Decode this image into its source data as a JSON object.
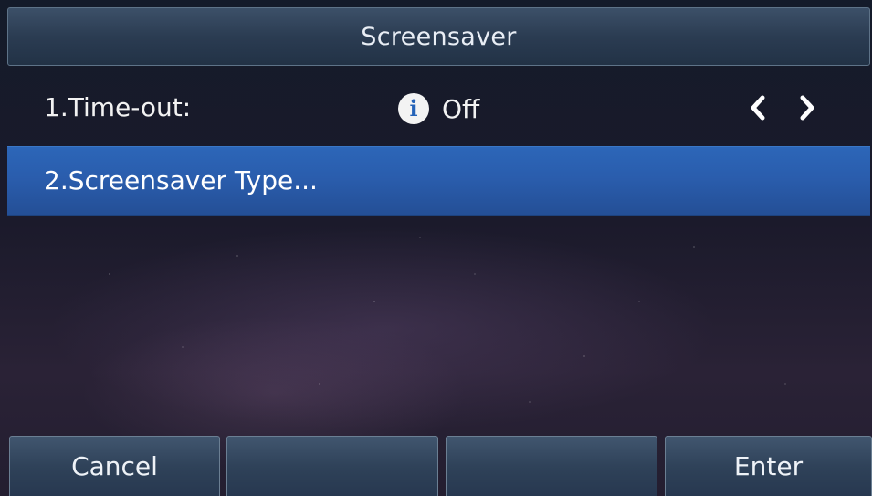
{
  "title": "Screensaver",
  "menu": {
    "items": [
      {
        "label": "1.Time-out:",
        "value": "Off",
        "info_icon": "info-icon",
        "selected": false
      },
      {
        "label": "2.Screensaver Type...",
        "selected": true
      }
    ]
  },
  "softkeys": [
    "Cancel",
    "",
    "",
    "Enter"
  ],
  "colors": {
    "highlight": "#2a5dad",
    "titlebar": "#2b3c52",
    "softkey": "#2f4259",
    "text": "#f2f2f2"
  },
  "icons": {
    "left": "chevron-left-icon",
    "right": "chevron-right-icon",
    "info": "info-icon"
  }
}
